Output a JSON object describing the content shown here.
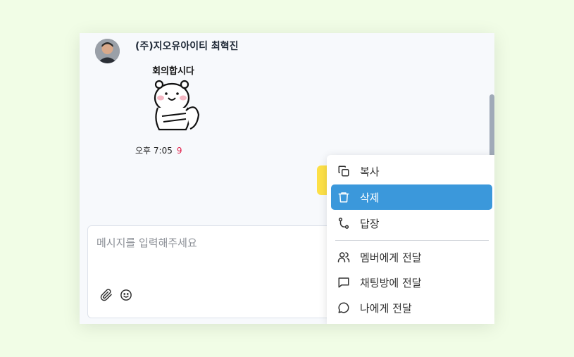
{
  "message": {
    "sender": "(주)지오유아이티 최혁진",
    "sticker_text": "회의합시다",
    "time": "오후 7:05",
    "unread_count": "9"
  },
  "composer": {
    "placeholder": "메시지를 입력해주세요",
    "attach_icon": "paperclip-icon",
    "emoji_icon": "smile-icon"
  },
  "context_menu": {
    "items": [
      {
        "label": "복사",
        "icon": "copy-icon"
      },
      {
        "label": "삭제",
        "icon": "trash-icon",
        "active": true
      },
      {
        "label": "답장",
        "icon": "reply-icon"
      },
      {
        "label": "멤버에게 전달",
        "icon": "users-icon"
      },
      {
        "label": "채팅방에 전달",
        "icon": "chat-square-icon"
      },
      {
        "label": "나에게 전달",
        "icon": "chat-round-icon"
      }
    ],
    "active_color": "#3b98db"
  },
  "colors": {
    "background": "#f1fde6",
    "my_bubble": "#fde047"
  }
}
